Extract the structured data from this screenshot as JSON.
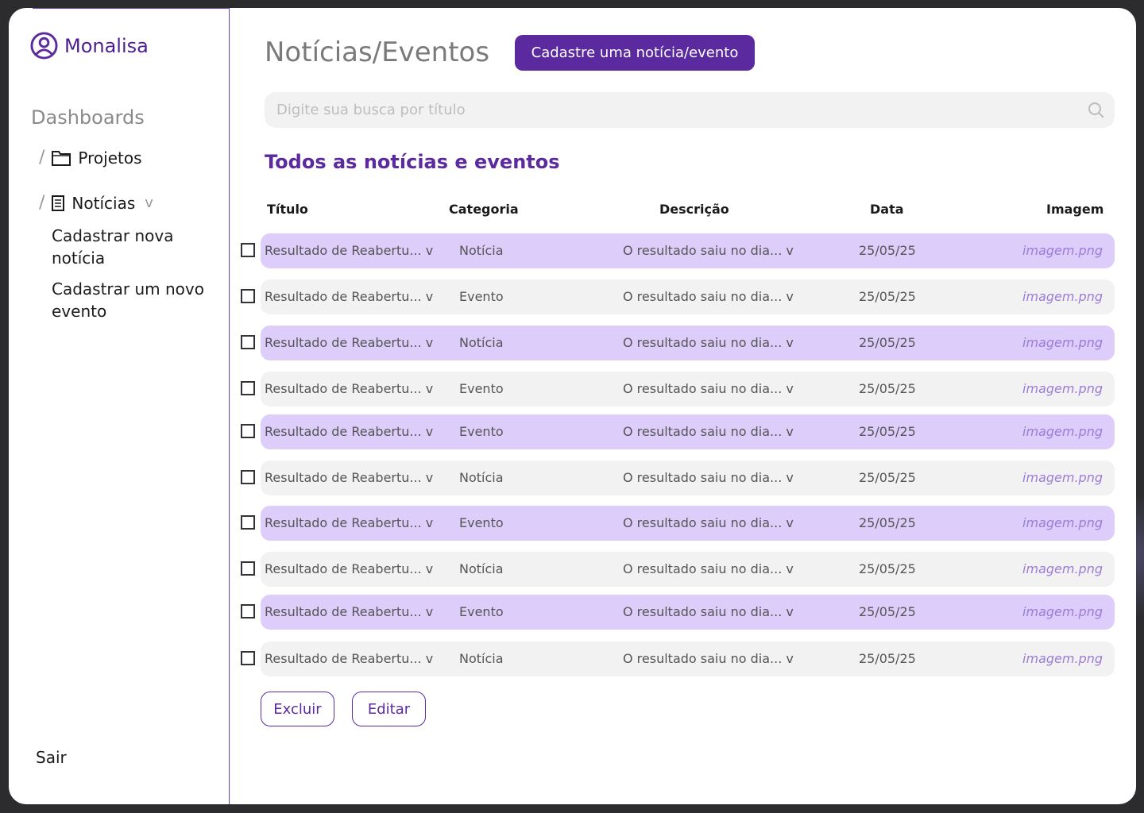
{
  "brand": {
    "name": "Monalisa"
  },
  "sidebar": {
    "section_title": "Dashboards",
    "items": [
      {
        "label": "Projetos",
        "icon": "folder-icon"
      },
      {
        "label": "Notícias",
        "icon": "document-icon",
        "chevron": "v"
      }
    ],
    "subitems": [
      {
        "label": "Cadastrar nova notícia"
      },
      {
        "label": "Cadastrar um novo evento"
      }
    ],
    "logout_label": "Sair"
  },
  "header": {
    "title": "Notícias/Eventos",
    "cta_label": "Cadastre uma notícia/evento"
  },
  "search": {
    "placeholder": "Digite sua busca por título"
  },
  "section": {
    "title": "Todos as notícias e eventos"
  },
  "table": {
    "columns": [
      "Título",
      "Categoria",
      "Descrição",
      "Data",
      "Imagem"
    ],
    "rows": [
      {
        "title": "Resultado de Reabertu... v",
        "category": "Notícia",
        "description": "O resultado saiu no dia... v",
        "date": "25/05/25",
        "image": "imagem.png"
      },
      {
        "title": "Resultado de Reabertu... v",
        "category": "Evento",
        "description": "O resultado saiu no dia... v",
        "date": "25/05/25",
        "image": "imagem.png"
      },
      {
        "title": "Resultado de Reabertu... v",
        "category": "Notícia",
        "description": "O resultado saiu no dia... v",
        "date": "25/05/25",
        "image": "imagem.png"
      },
      {
        "title": "Resultado de Reabertu... v",
        "category": "Evento",
        "description": "O resultado saiu no dia... v",
        "date": "25/05/25",
        "image": "imagem.png"
      },
      {
        "title": "Resultado de Reabertu... v",
        "category": "Evento",
        "description": "O resultado saiu no dia... v",
        "date": "25/05/25",
        "image": "imagem.png"
      },
      {
        "title": "Resultado de Reabertu... v",
        "category": "Notícia",
        "description": "O resultado saiu no dia... v",
        "date": "25/05/25",
        "image": "imagem.png"
      },
      {
        "title": "Resultado de Reabertu... v",
        "category": "Evento",
        "description": "O resultado saiu no dia... v",
        "date": "25/05/25",
        "image": "imagem.png"
      },
      {
        "title": "Resultado de Reabertu... v",
        "category": "Notícia",
        "description": "O resultado saiu no dia... v",
        "date": "25/05/25",
        "image": "imagem.png"
      },
      {
        "title": "Resultado de Reabertu... v",
        "category": "Evento",
        "description": "O resultado saiu no dia... v",
        "date": "25/05/25",
        "image": "imagem.png"
      },
      {
        "title": "Resultado de Reabertu... v",
        "category": "Notícia",
        "description": "O resultado saiu no dia... v",
        "date": "25/05/25",
        "image": "imagem.png"
      }
    ]
  },
  "actions": {
    "delete_label": "Excluir",
    "edit_label": "Editar"
  },
  "colors": {
    "accent": "#5a2a9e",
    "row_highlight": "#dccdfa",
    "row_neutral": "#f2f2f2",
    "link": "#9d7bd8"
  }
}
